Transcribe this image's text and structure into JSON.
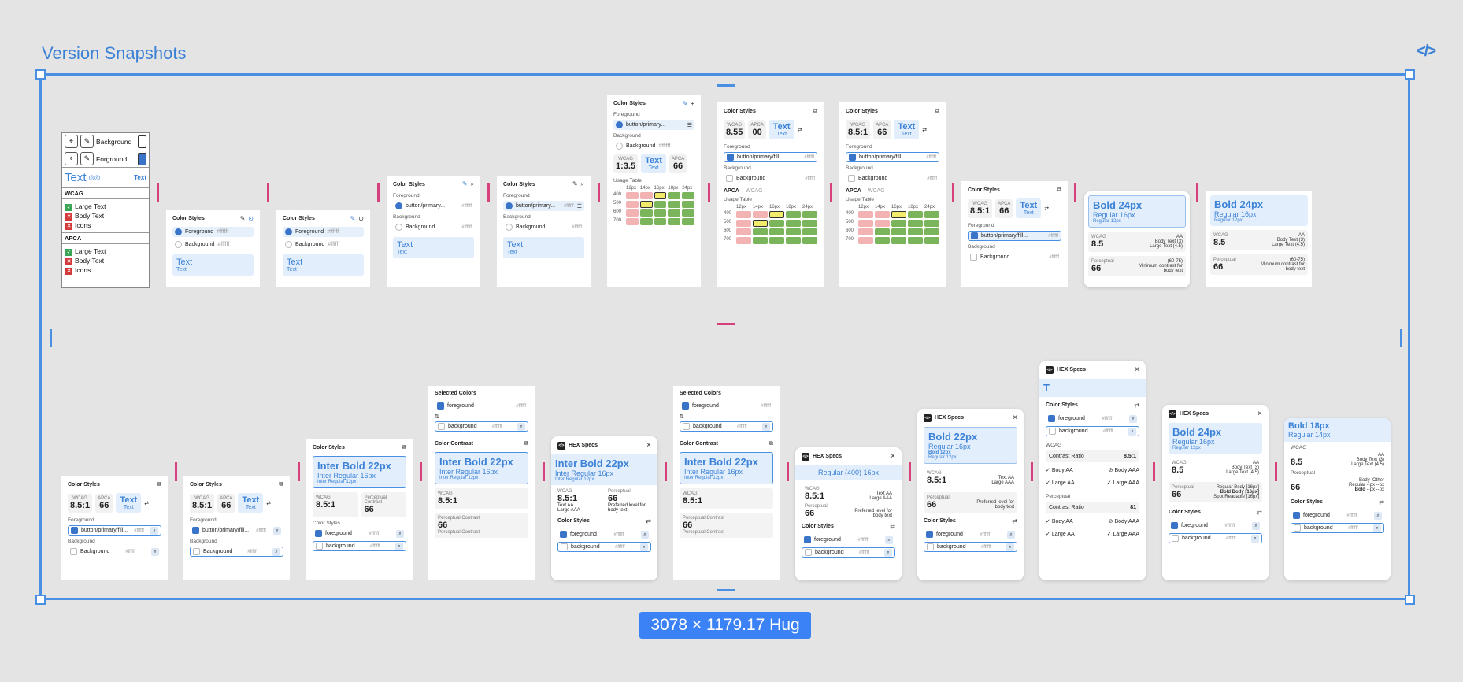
{
  "title": "Version Snapshots",
  "size_label": "3078 × 1179.17 Hug",
  "accent": "#4a90e2",
  "v1": {
    "background": "Background",
    "foreground": "Forground",
    "text": "Text",
    "text_small": "Text",
    "wcag": "WCAG",
    "apca": "APCA",
    "large": "Large Text",
    "body": "Body Text",
    "icons": "Icons"
  },
  "common": {
    "color_styles": "Color Styles",
    "foreground": "Foreground",
    "background": "Background",
    "hex": "#ffffff",
    "text": "Text",
    "wcag": "WCAG",
    "apca": "APCA",
    "usage": "Usage Table",
    "btn": "button/primary...",
    "btn2": "button/primary/fill...",
    "fg": "foreground",
    "bg": "background",
    "hexspecs": "HEX Specs",
    "selected": "Selected Colors",
    "contrast": "Color Contrast",
    "perc": "Perceptual",
    "perc_contrast": "Perceptual Contrast",
    "r1353": "1:3.5",
    "v855": "8.55",
    "v00": "00",
    "v851": "8.5:1",
    "v85": "8.5",
    "v66": "66",
    "v81": "81",
    "bold24": "Bold 24px",
    "bold22": "Bold 22px",
    "bold18": "Bold 18px",
    "reg16": "Regular 16px",
    "reg14": "Regular 14px",
    "reg12": "Regular 12px",
    "bold12": "Bold 12px",
    "ib22": "Inter Bold 22px",
    "ir16": "Inter Regular 16px",
    "ir12": "Inter Regular 12px",
    "r400": "Regular (400) 16px",
    "bt3": "Body Text (3)",
    "lt45": "Large Text (4.5)",
    "aa": "AA",
    "range": "(60-75)",
    "minc": "Minimum contrast for body text",
    "pref": "Preferred level for body text",
    "textaa": "Text AA",
    "largeaaa": "Large AAA",
    "cratio": "Contrast Ratio",
    "bodyaa": "Body AA",
    "bodyaaa": "Body AAA",
    "largeaa": "Large AA",
    "t": "T",
    "sizes": [
      "12px",
      "14px",
      "16px",
      "18px",
      "24px"
    ],
    "weights": [
      "400",
      "500",
      "600",
      "700"
    ],
    "regbody": "Regular Body [16px]",
    "boldbody": "Bold Body [16px]",
    "spot": "Spot Readable [16px]",
    "body": "Body",
    "other": "Other",
    "regular": "Regular",
    "bold": "Bold",
    "px": "--px"
  }
}
